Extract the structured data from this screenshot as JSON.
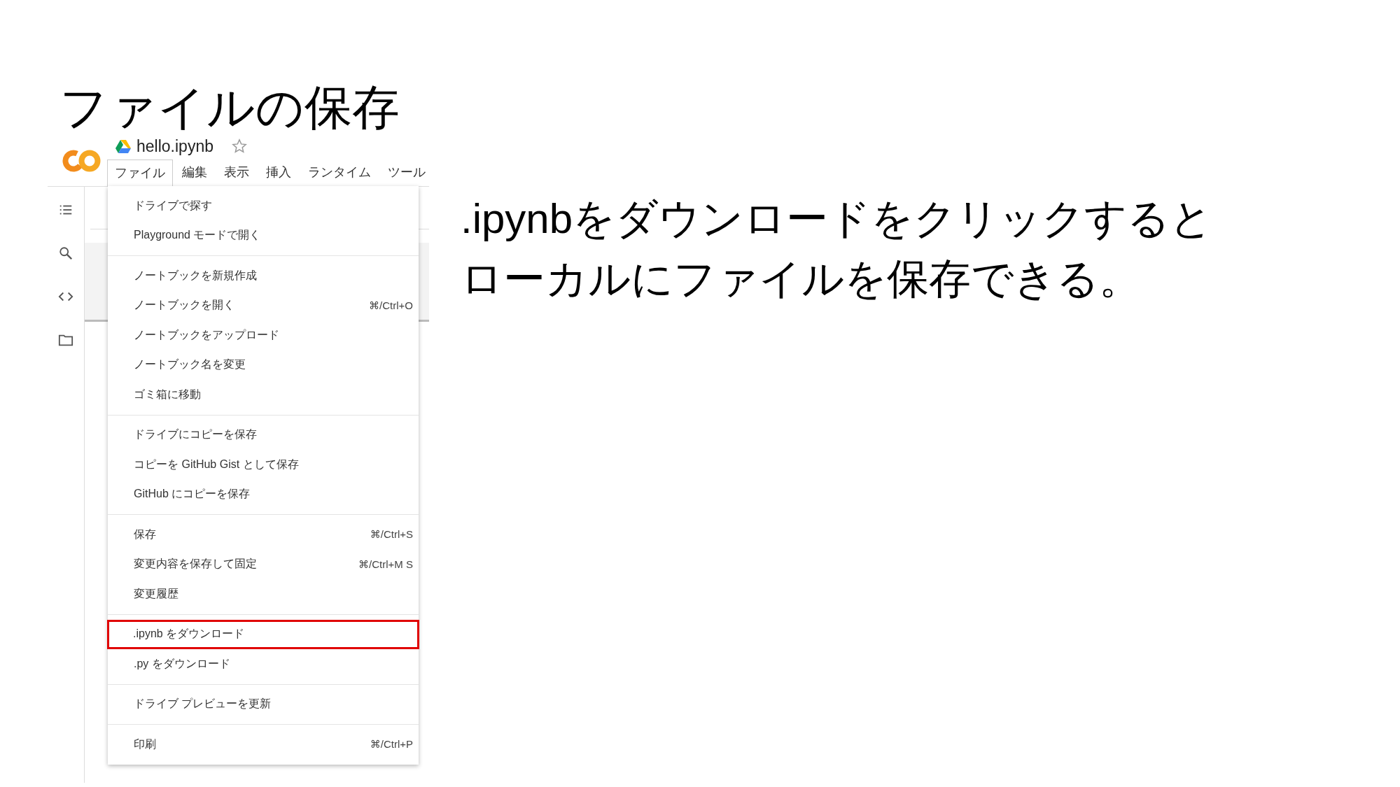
{
  "slide_title": "ファイルの保存",
  "screenshot": {
    "file_name": "hello.ipynb",
    "menu_bar": [
      {
        "label": "ファイル",
        "selected": true
      },
      {
        "label": "編集",
        "selected": false
      },
      {
        "label": "表示",
        "selected": false
      },
      {
        "label": "挿入",
        "selected": false
      },
      {
        "label": "ランタイム",
        "selected": false
      },
      {
        "label": "ツール",
        "selected": false
      }
    ],
    "file_menu": [
      [
        {
          "label": "ドライブで探す",
          "highlighted": false
        },
        {
          "label": "Playground モードで開く",
          "highlighted": false
        }
      ],
      [
        {
          "label": "ノートブックを新規作成",
          "highlighted": false
        },
        {
          "label": "ノートブックを開く",
          "shortcut": "⌘/Ctrl+O",
          "highlighted": false
        },
        {
          "label": "ノートブックをアップロード",
          "highlighted": false
        },
        {
          "label": "ノートブック名を変更",
          "highlighted": false
        },
        {
          "label": "ゴミ箱に移動",
          "highlighted": false
        }
      ],
      [
        {
          "label": "ドライブにコピーを保存",
          "highlighted": false
        },
        {
          "label": "コピーを GitHub Gist として保存",
          "highlighted": false
        },
        {
          "label": "GitHub にコピーを保存",
          "highlighted": false
        }
      ],
      [
        {
          "label": "保存",
          "shortcut": "⌘/Ctrl+S",
          "highlighted": false
        },
        {
          "label": "変更内容を保存して固定",
          "shortcut": "⌘/Ctrl+M S",
          "highlighted": false
        },
        {
          "label": "変更履歴",
          "highlighted": false
        }
      ],
      [
        {
          "label": ".ipynb をダウンロード",
          "highlighted": true
        },
        {
          "label": ".py をダウンロード",
          "highlighted": false
        }
      ],
      [
        {
          "label": "ドライブ プレビューを更新",
          "highlighted": false
        }
      ],
      [
        {
          "label": "印刷",
          "shortcut": "⌘/Ctrl+P",
          "highlighted": false
        }
      ]
    ]
  },
  "description": [
    ".ipynbをダウンロードをクリックすると",
    "ローカルにファイルを保存できる。"
  ]
}
